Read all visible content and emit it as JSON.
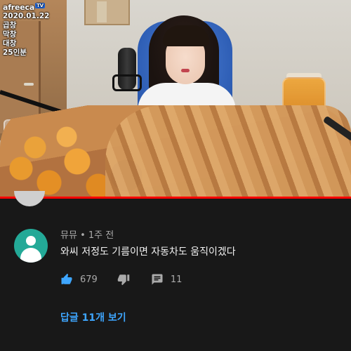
{
  "video": {
    "logo_text": "afreeca",
    "logo_badge": "TV",
    "overlay_lines": [
      "2020.01.22",
      "곱창",
      "막창",
      "대창",
      "25인분"
    ],
    "progress_fraction": 1.0
  },
  "comment": {
    "author": "뮤뮤",
    "separator": "•",
    "time_ago": "1주 전",
    "text": "와씨 저정도 기름이면 자동차도 움직이겠다",
    "like_count": "679",
    "reply_count": "11",
    "view_replies_label": "답글 11개 보기"
  },
  "icons": {
    "like": "thumbs-up-icon",
    "dislike": "thumbs-down-icon",
    "reply": "comment-icon",
    "avatar": "default-user-avatar"
  },
  "colors": {
    "background": "#181818",
    "link": "#3ea6ff",
    "avatar": "#23a997",
    "progress": "#ff0000"
  }
}
